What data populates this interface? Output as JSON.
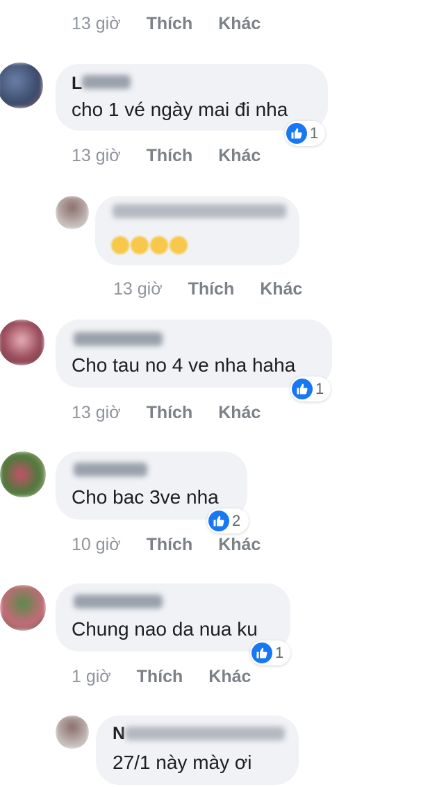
{
  "top": {
    "time": "13 giờ",
    "like": "Thích",
    "more": "Khác"
  },
  "comments": [
    {
      "name_initial": "L",
      "text": "cho 1 vé ngày mai đi nha",
      "reactions": "1",
      "time": "13 giờ",
      "like": "Thích",
      "more": "Khác"
    },
    {
      "name_initial": "",
      "text": "",
      "reactions": "",
      "time": "13 giờ",
      "like": "Thích",
      "more": "Khác"
    },
    {
      "name_initial": "",
      "text": "Cho tau no 4 ve nha haha",
      "reactions": "1",
      "time": "13 giờ",
      "like": "Thích",
      "more": "Khác"
    },
    {
      "name_initial": "",
      "text": "Cho bac 3ve nha",
      "reactions": "2",
      "time": "10 giờ",
      "like": "Thích",
      "more": "Khác"
    },
    {
      "name_initial": "",
      "text": "Chung nao da nua ku",
      "reactions": "1",
      "time": "1 giờ",
      "like": "Thích",
      "more": "Khác"
    },
    {
      "name_initial": "N",
      "text": "27/1 này mày ơi",
      "reactions": "",
      "time": "",
      "like": "",
      "more": ""
    }
  ],
  "colors": {
    "like_blue": "#1877f2",
    "bubble": "#f0f2f5",
    "meta_text": "#8a8d91"
  },
  "icons": {
    "like": "thumbs-up-icon",
    "emoji": "laughing-emoji-icon"
  }
}
